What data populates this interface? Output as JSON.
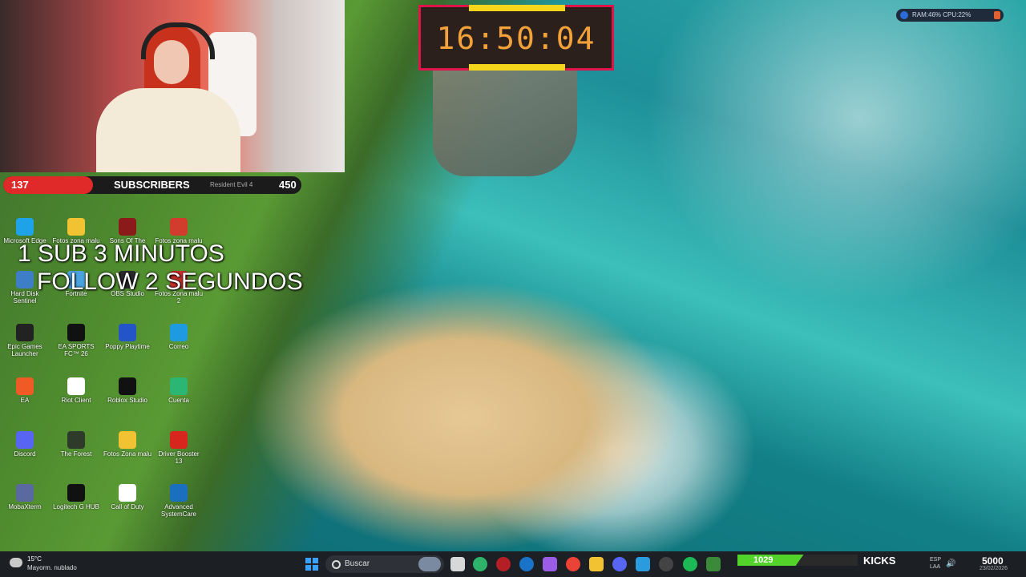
{
  "stream_overlay": {
    "clock": "16:50:04",
    "subscribers": {
      "current": "137",
      "label": "SUBSCRIBERS",
      "game": "Resident Evil 4",
      "goal": "450",
      "progress": 0.3
    },
    "overlay_line1": "1 SUB 3 MINUTOS",
    "overlay_line2": "FOLLOW 2 SEGUNDOS",
    "perf": "RAM:46%  CPU:22%",
    "kicks": {
      "count": "1029",
      "label": "KICKS",
      "progress": 0.55
    },
    "goal_counter": "5000"
  },
  "desktop_icons": [
    {
      "label": "Microsoft Edge",
      "color": "#1fa3e8"
    },
    {
      "label": "Fotos zona malu",
      "color": "#f1c232"
    },
    {
      "label": "Sons Of The",
      "color": "#8b1a1a"
    },
    {
      "label": "Fotos zona malu",
      "color": "#d23c2c"
    },
    {
      "label": "Hard Disk Sentinel",
      "color": "#3d7ec7"
    },
    {
      "label": "Fortnite",
      "color": "#4aa3df"
    },
    {
      "label": "OBS Studio",
      "color": "#2a2a2a"
    },
    {
      "label": "Fotos Zona malu 2",
      "color": "#c9302c"
    },
    {
      "label": "Epic Games Launcher",
      "color": "#222222"
    },
    {
      "label": "EA SPORTS FC™ 26",
      "color": "#111111"
    },
    {
      "label": "Poppy Playtime",
      "color": "#2355c8"
    },
    {
      "label": "Correo",
      "color": "#1e9be0"
    },
    {
      "label": "EA",
      "color": "#f05a24"
    },
    {
      "label": "Riot Client",
      "color": "#ffffff"
    },
    {
      "label": "Roblox Studio",
      "color": "#111111"
    },
    {
      "label": "Cuenta",
      "color": "#2bb673"
    },
    {
      "label": "Discord",
      "color": "#5865f2"
    },
    {
      "label": "The Forest",
      "color": "#2e3b2a"
    },
    {
      "label": "Fotos Zona malu",
      "color": "#f1c232"
    },
    {
      "label": "Driver Booster 13",
      "color": "#d7261e"
    },
    {
      "label": "MobaXterm",
      "color": "#5a6aa0"
    },
    {
      "label": "Logitech G HUB",
      "color": "#111111"
    },
    {
      "label": "Call of Duty",
      "color": "#ffffff"
    },
    {
      "label": "Advanced SystemCare",
      "color": "#1b6fbf"
    }
  ],
  "taskbar": {
    "weather_temp": "15°C",
    "weather_desc": "Mayorm. nublado",
    "search_placeholder": "Buscar",
    "lang": "ESP\nLAA",
    "date": "23/02/2026"
  }
}
